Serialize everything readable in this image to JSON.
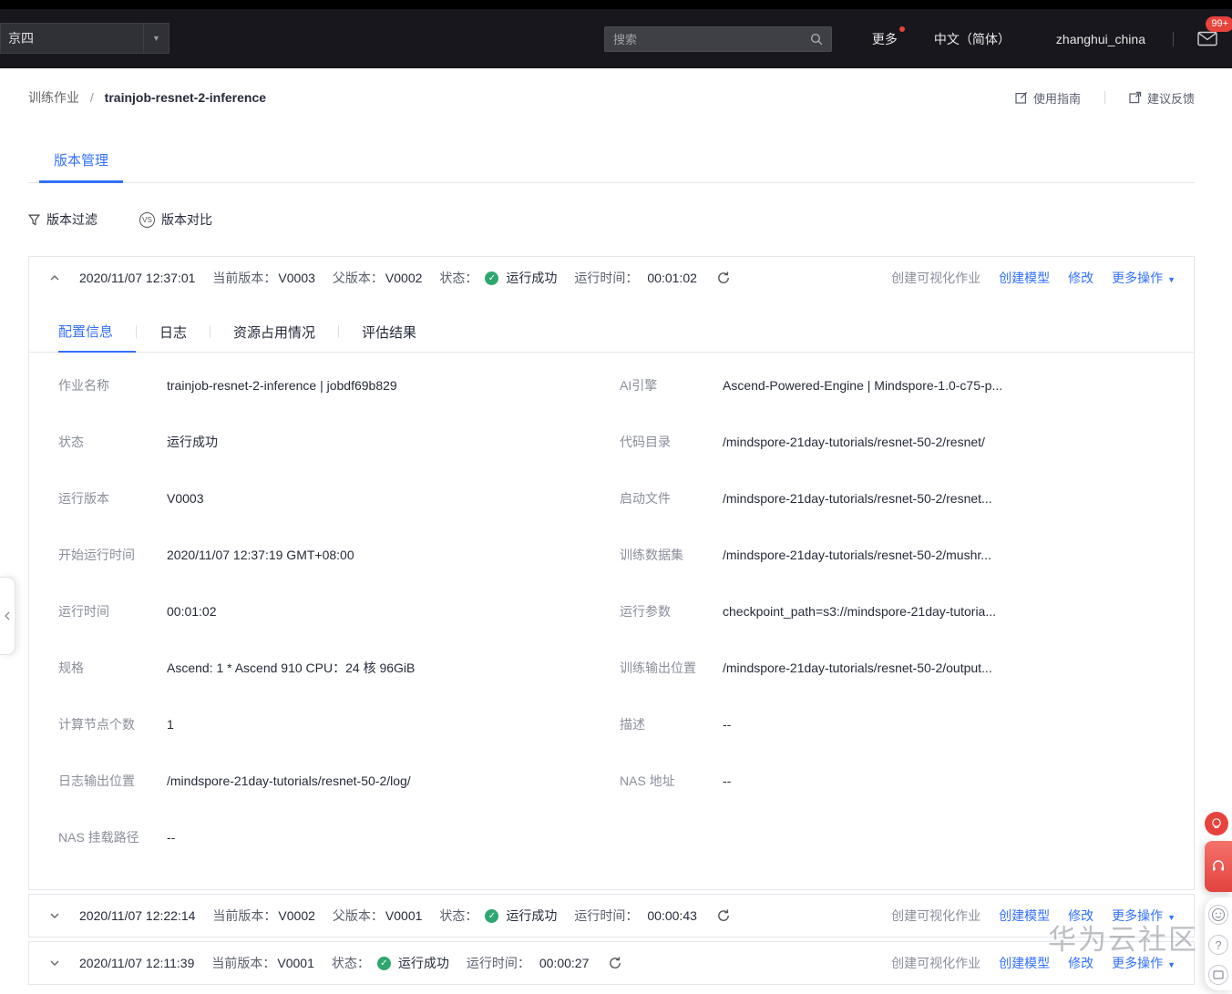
{
  "colors": {
    "accent_blue": "#3370ff",
    "success_green": "#2da76e",
    "badge_red": "#e6433c",
    "header_bg": "#17171d"
  },
  "icons": {
    "dropdown_caret": "▼",
    "check": "✓",
    "vs": "VS",
    "question": "?"
  },
  "header": {
    "region_label": "京四",
    "search_placeholder": "搜索",
    "more_label": "更多",
    "language": "中文（简体）",
    "username": "zhanghui_china",
    "mail_badge": "99+"
  },
  "breadcrumb": {
    "parent": "训练作业",
    "separator": "/",
    "current": "trainjob-resnet-2-inference"
  },
  "top_links": {
    "guide": "使用指南",
    "feedback": "建议反馈"
  },
  "page_tab": "版本管理",
  "toolbar": {
    "filter": "版本过滤",
    "compare": "版本对比"
  },
  "labels": {
    "current_version": "当前版本：",
    "parent_version": "父版本：",
    "status": "状态：",
    "runtime": "运行时间："
  },
  "actions": {
    "create_viz": "创建可视化作业",
    "create_model": "创建模型",
    "modify": "修改",
    "more": "更多操作"
  },
  "versions": [
    {
      "timestamp": "2020/11/07 12:37:01",
      "current": "V0003",
      "parent": "V0002",
      "status": "运行成功",
      "runtime": "00:01:02"
    },
    {
      "timestamp": "2020/11/07 12:22:14",
      "current": "V0002",
      "parent": "V0001",
      "status": "运行成功",
      "runtime": "00:00:43"
    },
    {
      "timestamp": "2020/11/07 12:11:39",
      "current": "V0001",
      "status": "运行成功",
      "runtime": "00:00:27"
    }
  ],
  "detail_tabs": [
    {
      "label": "配置信息"
    },
    {
      "label": "日志"
    },
    {
      "label": "资源占用情况"
    },
    {
      "label": "评估结果"
    }
  ],
  "details": {
    "left": [
      {
        "label": "作业名称",
        "value": "trainjob-resnet-2-inference | jobdf69b829"
      },
      {
        "label": "状态",
        "value": "运行成功"
      },
      {
        "label": "运行版本",
        "value": "V0003"
      },
      {
        "label": "开始运行时间",
        "value": "2020/11/07 12:37:19 GMT+08:00"
      },
      {
        "label": "运行时间",
        "value": "00:01:02"
      },
      {
        "label": "规格",
        "value": "Ascend: 1 * Ascend 910 CPU：24 核 96GiB"
      },
      {
        "label": "计算节点个数",
        "value": "1"
      },
      {
        "label": "日志输出位置",
        "value": "/mindspore-21day-tutorials/resnet-50-2/log/"
      },
      {
        "label": "NAS 挂载路径",
        "value": "--"
      }
    ],
    "right": [
      {
        "label": "AI引擎",
        "value": "Ascend-Powered-Engine | Mindspore-1.0-c75-p..."
      },
      {
        "label": "代码目录",
        "value": "/mindspore-21day-tutorials/resnet-50-2/resnet/"
      },
      {
        "label": "启动文件",
        "value": "/mindspore-21day-tutorials/resnet-50-2/resnet..."
      },
      {
        "label": "训练数据集",
        "value": "/mindspore-21day-tutorials/resnet-50-2/mushr..."
      },
      {
        "label": "运行参数",
        "value": "checkpoint_path=s3://mindspore-21day-tutoria..."
      },
      {
        "label": "训练输出位置",
        "value": "/mindspore-21day-tutorials/resnet-50-2/output..."
      },
      {
        "label": "描述",
        "value": "--"
      },
      {
        "label": "NAS 地址",
        "value": "--"
      }
    ]
  },
  "watermark": "华为云社区"
}
